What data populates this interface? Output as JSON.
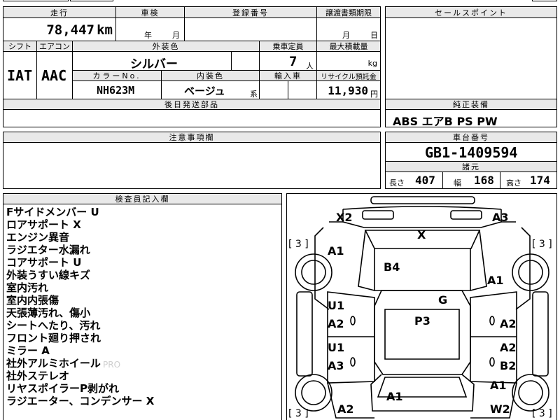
{
  "header_row": {
    "mileage_label": "走行",
    "inspection_label": "車検",
    "registration_label": "登録番号",
    "transfer_label": "譲渡書類期限",
    "sales_point_label": "セールスポイント"
  },
  "mileage": {
    "value": "78,447",
    "unit": "km"
  },
  "inspection": {
    "year_unit": "年",
    "month_unit": "月"
  },
  "transfer_deadline": {
    "month_unit": "月",
    "day_unit": "日"
  },
  "row2": {
    "shift_label": "シフト",
    "aircon_label": "エアコン",
    "exterior_color_label": "外装色",
    "capacity_label": "乗車定員",
    "max_load_label": "最大積載量",
    "shift_value": "IAT",
    "aircon_value": "AAC",
    "exterior_color_value": "シルバー",
    "capacity_value": "7",
    "capacity_unit": "人",
    "max_load_unit": "kg",
    "color_no_label": "カラーNo.",
    "interior_color_label": "内装色",
    "import_label": "輸入車",
    "recycle_label": "リサイクル預託金",
    "color_no_value": "NH623M",
    "interior_color_value": "ベージュ",
    "interior_suffix": "系",
    "recycle_value": "11,930",
    "recycle_unit": "円",
    "delivery_label": "後日発送部品"
  },
  "equipment": {
    "label": "純正装備",
    "value": "ABS エアB PS PW"
  },
  "caution": {
    "label": "注意事項欄"
  },
  "chassis": {
    "label": "車台番号",
    "value": "GB1-1409594",
    "dims_label": "諸元",
    "length_label": "長さ",
    "length_value": "407",
    "width_label": "幅",
    "width_value": "168",
    "height_label": "高さ",
    "height_value": "174"
  },
  "inspector": {
    "label": "検査員記入欄",
    "notes": [
      "Fサイドメンバー U",
      "ロアサポート X",
      "エンジン異音",
      "ラジエター水漏れ",
      "コアサポート U",
      "外装うすい線キズ",
      "室内汚れ",
      "室内内張傷",
      "天張薄汚れ、傷小",
      "シートへたり、汚れ",
      "フロント廻り押され",
      "ミラー A",
      "社外アルミホイール",
      "社外ステレオ",
      "リヤスポイラーP剥がれ",
      "ラジエーター、コンデンサー X"
    ],
    "watermark": "PRO"
  },
  "diagram": {
    "tire_marks": [
      "[ 3 ]",
      "[ 3 ]",
      "[ 3 ]",
      "[ 3 ]"
    ],
    "marks": {
      "x2": "X2",
      "a3_top": "A3",
      "x": "X",
      "a1_fl": "A1",
      "b4": "B4",
      "a1_fr": "A1",
      "g": "G",
      "u1_l1": "U1",
      "a2_l1": "A2",
      "p3": "P3",
      "a2_r1": "A2",
      "u1_l2": "U1",
      "a3_l2": "A3",
      "a2_r2": "A2",
      "b2_r2": "B2",
      "a1_rear": "A1",
      "a1_rr": "A1",
      "a2_rl": "A2",
      "w2": "W2"
    }
  }
}
